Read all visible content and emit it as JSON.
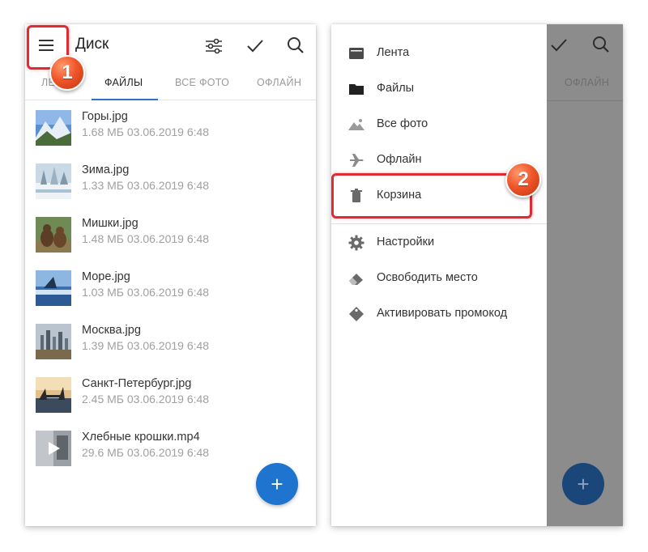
{
  "left": {
    "title": "Диск",
    "tabs": [
      {
        "label": "ЛЕ"
      },
      {
        "label": "ФАЙЛЫ"
      },
      {
        "label": "ВСЕ ФОТО"
      },
      {
        "label": "ОФЛАЙН"
      }
    ],
    "active_tab": "ФАЙЛЫ",
    "files": [
      {
        "name": "Горы.jpg",
        "meta": "1.68 МБ 03.06.2019 6:48",
        "thumb": "mountains-thumbnail"
      },
      {
        "name": "Зима.jpg",
        "meta": "1.33 МБ 03.06.2019 6:48",
        "thumb": "winter-thumbnail"
      },
      {
        "name": "Мишки.jpg",
        "meta": "1.48 МБ 03.06.2019 6:48",
        "thumb": "bears-thumbnail"
      },
      {
        "name": "Море.jpg",
        "meta": "1.03 МБ 03.06.2019 6:48",
        "thumb": "sea-thumbnail"
      },
      {
        "name": "Москва.jpg",
        "meta": "1.39 МБ 03.06.2019 6:48",
        "thumb": "moscow-thumbnail"
      },
      {
        "name": "Санкт-Петербург.jpg",
        "meta": "2.45 МБ 03.06.2019 6:48",
        "thumb": "saint-petersburg-thumbnail"
      },
      {
        "name": "Хлебные крошки.mp4",
        "meta": "29.6 МБ 03.06.2019 6:48",
        "thumb": "video-thumbnail"
      }
    ],
    "fab_label": "+",
    "badge": "1"
  },
  "right": {
    "drawer_items": [
      {
        "label": "Лента",
        "icon": "feed-icon"
      },
      {
        "label": "Файлы",
        "icon": "folder-icon"
      },
      {
        "label": "Все фото",
        "icon": "photos-icon"
      },
      {
        "label": "Офлайн",
        "icon": "airplane-icon"
      },
      {
        "label": "Корзина",
        "icon": "trash-icon"
      },
      {
        "label": "Настройки",
        "icon": "gear-icon"
      },
      {
        "label": "Освободить место",
        "icon": "eraser-icon"
      },
      {
        "label": "Активировать промокод",
        "icon": "tag-icon"
      }
    ],
    "scrim_tab": "ОФЛАЙН",
    "fab_label": "+",
    "badge": "2"
  },
  "colors": {
    "accent": "#1f74cf",
    "highlight": "#e02b32",
    "badge": "#f0562a",
    "scrim": "#8c8c8c"
  }
}
